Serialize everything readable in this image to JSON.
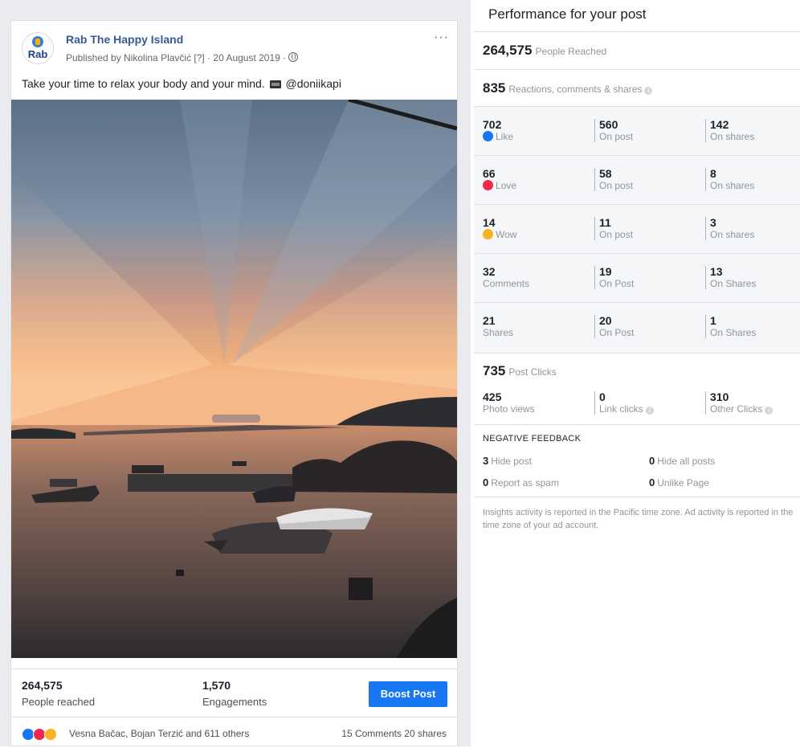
{
  "post": {
    "page_name": "Rab The Happy Island",
    "avatar_text": "Rab",
    "published_by": "Published by Nikolina Plavčić [?] · 20 August 2019 ·",
    "more_label": "···",
    "caption_before": "Take your time to relax your body and your mind.",
    "caption_after": "@doniikapi",
    "stats": {
      "reached_value": "264,575",
      "reached_label": "People reached",
      "engagements_value": "1,570",
      "engagements_label": "Engagements"
    },
    "boost_label": "Boost Post",
    "reactors": "Vesna Bačac, Bojan Terzić and 611 others",
    "comments_shares": "15 Comments  20 shares"
  },
  "performance": {
    "title": "Performance for your post",
    "people_reached_value": "264,575",
    "people_reached_label": "People Reached",
    "engagement_value": "835",
    "engagement_label": "Reactions, comments & shares",
    "info_glyph": "i",
    "rows": [
      {
        "total": "702",
        "label": "Like",
        "icon": "like-icon",
        "on_post": "560",
        "on_post_label": "On post",
        "on_shares": "142",
        "on_shares_label": "On shares"
      },
      {
        "total": "66",
        "label": "Love",
        "icon": "love-icon",
        "on_post": "58",
        "on_post_label": "On post",
        "on_shares": "8",
        "on_shares_label": "On shares"
      },
      {
        "total": "14",
        "label": "Wow",
        "icon": "wow-icon",
        "on_post": "11",
        "on_post_label": "On post",
        "on_shares": "3",
        "on_shares_label": "On shares"
      },
      {
        "total": "32",
        "label": "Comments",
        "icon": "",
        "on_post": "19",
        "on_post_label": "On Post",
        "on_shares": "13",
        "on_shares_label": "On Shares"
      },
      {
        "total": "21",
        "label": "Shares",
        "icon": "",
        "on_post": "20",
        "on_post_label": "On Post",
        "on_shares": "1",
        "on_shares_label": "On Shares"
      }
    ],
    "post_clicks_value": "735",
    "post_clicks_label": "Post Clicks",
    "clicks": {
      "photo_views": "425",
      "photo_views_label": "Photo views",
      "link_clicks": "0",
      "link_clicks_label": "Link clicks",
      "other_clicks": "310",
      "other_clicks_label": "Other Clicks"
    },
    "negative": {
      "title": "NEGATIVE FEEDBACK",
      "hide_post": "3",
      "hide_post_label": "Hide post",
      "hide_all": "0",
      "hide_all_label": "Hide all posts",
      "spam": "0",
      "spam_label": "Report as spam",
      "unlike": "0",
      "unlike_label": "Unlike Page"
    },
    "footnote": "Insights activity is reported in the Pacific time zone. Ad activity is reported in the time zone of your ad account."
  },
  "colors": {
    "brand_blue": "#1877f2",
    "link_blue": "#385898",
    "love_red": "#f0284a",
    "wow_yellow": "#f7b125"
  }
}
